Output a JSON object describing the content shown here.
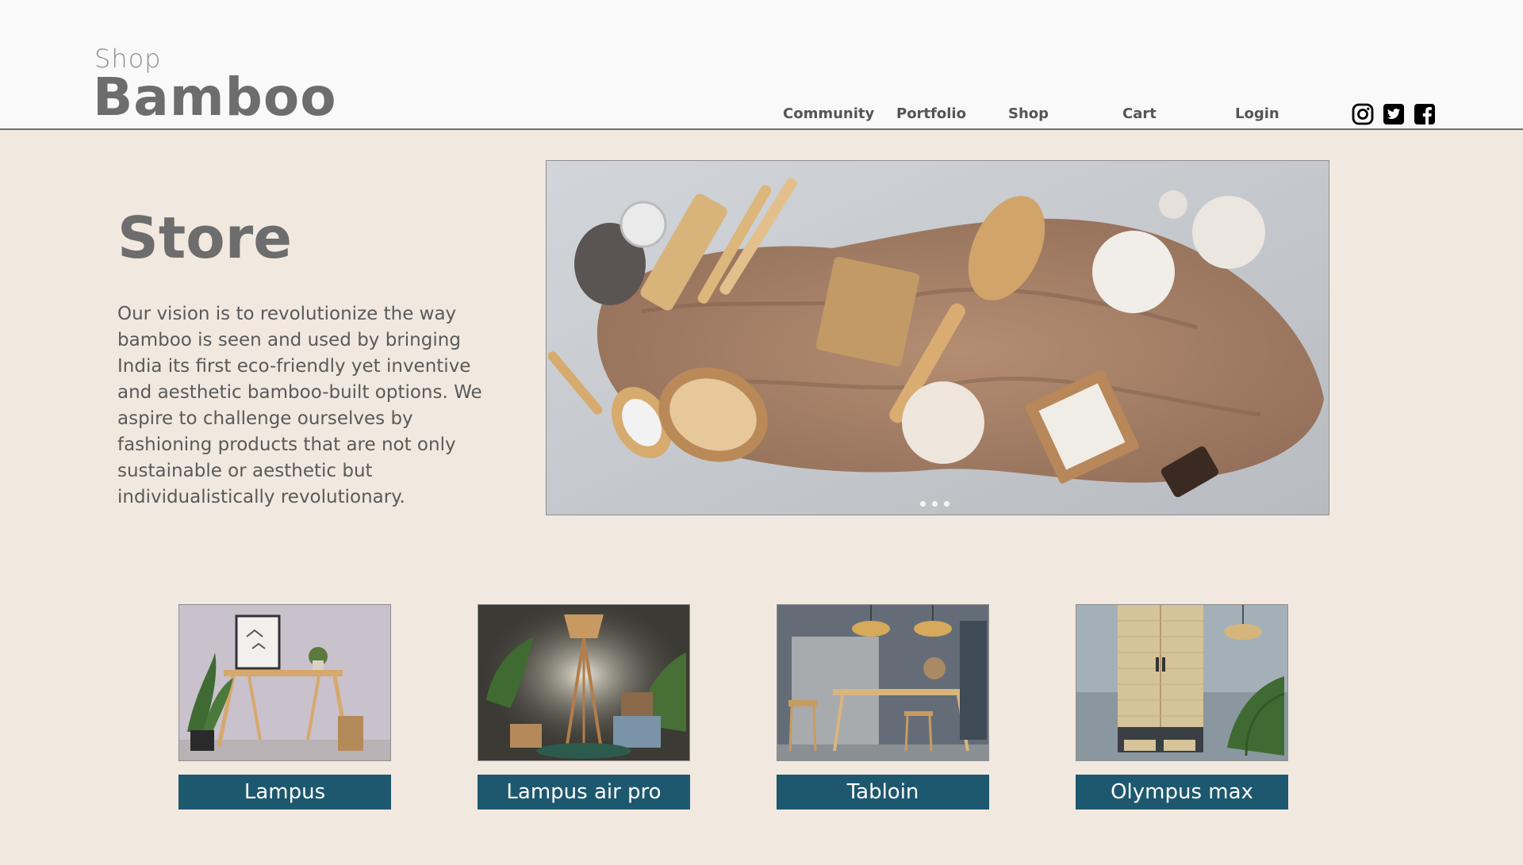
{
  "logo": {
    "top": "Shop",
    "main": "Bamboo"
  },
  "nav": {
    "items": [
      {
        "label": "Community"
      },
      {
        "label": "Portfolio"
      },
      {
        "label": "Shop"
      },
      {
        "label": "Cart"
      },
      {
        "label": "Login"
      }
    ]
  },
  "social": [
    "instagram-icon",
    "twitter-icon",
    "facebook-icon"
  ],
  "store": {
    "title": "Store",
    "description": "Our vision is to revolutionize the way bamboo is seen and used by bringing India its first eco-friendly yet inventive and aesthetic bamboo-built options. We aspire to challenge ourselves by fashioning products that are not only sustainable or aesthetic but individualistically revolutionary."
  },
  "carousel": {
    "slide_count": 3
  },
  "products": [
    {
      "name": "Lampus"
    },
    {
      "name": "Lampus air pro"
    },
    {
      "name": "Tabloin"
    },
    {
      "name": "Olympus max"
    }
  ],
  "colors": {
    "header_bg": "#f9f9f9",
    "page_bg": "#f1e8df",
    "label_bg": "#1d586e",
    "text_grey": "#6d6d6d"
  }
}
